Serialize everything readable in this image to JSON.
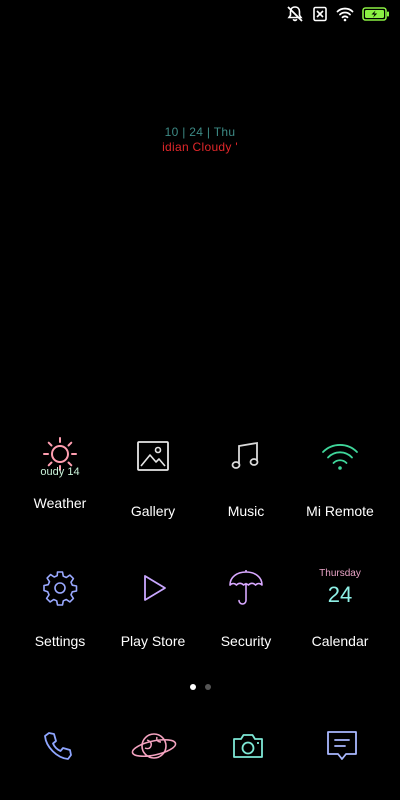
{
  "clock_widget": {
    "date_line": "10 | 24 | Thu",
    "weather_line": "idian Cloudy '"
  },
  "apps_row1": [
    {
      "label": "Weather",
      "sub": "oudy 14",
      "icon": "sun-icon",
      "color": "#ff9eb0"
    },
    {
      "label": "Gallery",
      "icon": "image-icon",
      "color": "#e6e6e6"
    },
    {
      "label": "Music",
      "icon": "music-note-icon",
      "color": "#d9d9d9"
    },
    {
      "label": "Mi Remote",
      "icon": "wifi-signal-icon",
      "color": "#3fd69a"
    }
  ],
  "apps_row2": [
    {
      "label": "Settings",
      "icon": "gear-icon",
      "color": "#9aa9ff"
    },
    {
      "label": "Play Store",
      "icon": "play-triangle-icon",
      "color": "#c9a7ff"
    },
    {
      "label": "Security",
      "icon": "umbrella-icon",
      "color": "#d8a8ff"
    },
    {
      "label": "Calendar",
      "icon": "calendar-icon",
      "day": "Thursday",
      "date": "24"
    }
  ],
  "dock": [
    {
      "icon": "phone-icon",
      "color": "#8fa6ff"
    },
    {
      "icon": "planet-icon",
      "color": "#f4a3c0"
    },
    {
      "icon": "camera-icon",
      "color": "#7ee8d6"
    },
    {
      "icon": "message-icon",
      "color": "#a9b8ff"
    }
  ],
  "page_indicator": {
    "current": 1,
    "total": 2
  },
  "status_bar": {
    "icons": [
      "notifications-off-icon",
      "sim-off-icon",
      "wifi-icon",
      "battery-charging-icon"
    ],
    "accent_color": "#8bf043"
  }
}
